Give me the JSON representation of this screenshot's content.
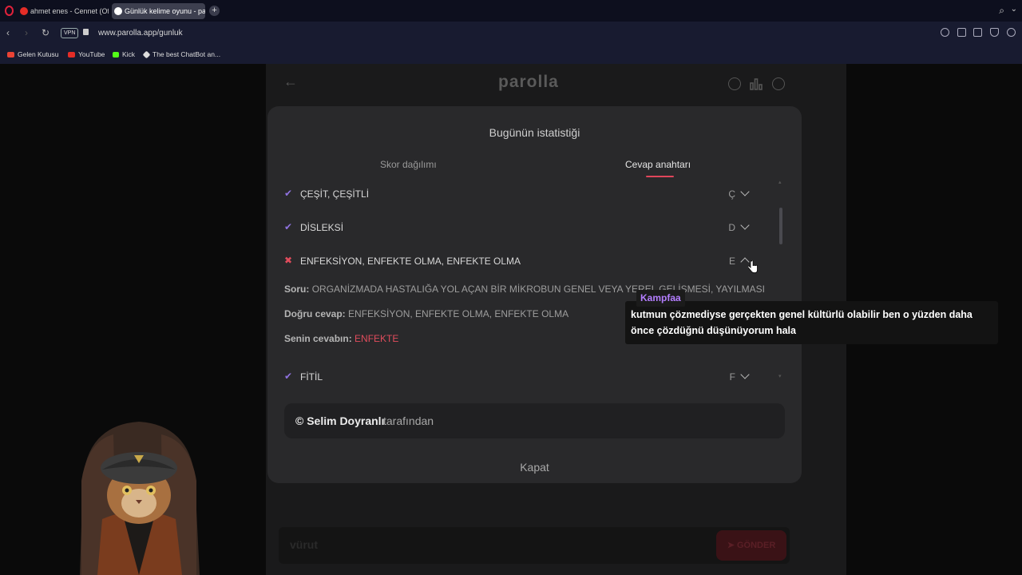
{
  "browser": {
    "tabs": [
      {
        "label": "ahmet enes - Cennet (Offi",
        "icon": "youtube-icon",
        "active": false
      },
      {
        "label": "Günlük kelime oyunu - pa",
        "icon": "parolla-icon",
        "active": true
      }
    ],
    "url": "www.parolla.app/gunluk",
    "vpn_label": "VPN",
    "bookmarks": [
      {
        "label": "Gelen Kutusu",
        "icon": "gmail-icon"
      },
      {
        "label": "YouTube",
        "icon": "youtube-icon"
      },
      {
        "label": "Kick",
        "icon": "kick-icon"
      },
      {
        "label": "The best ChatBot an...",
        "icon": "chatbot-icon"
      }
    ]
  },
  "app": {
    "logo": "parolla",
    "input_placeholder": "vürut",
    "send_label": "GÖNDER"
  },
  "modal": {
    "title": "Bugünün istatistiği",
    "tabs": [
      {
        "label": "Skor dağılımı",
        "active": false
      },
      {
        "label": "Cevap anahtarı",
        "active": true
      }
    ],
    "rows": [
      {
        "status": "correct",
        "answer": "ÇEŞİT, ÇEŞİTLİ",
        "letter": "Ç",
        "expanded": false
      },
      {
        "status": "correct",
        "answer": "DİSLEKSİ",
        "letter": "D",
        "expanded": false
      },
      {
        "status": "wrong",
        "answer": "ENFEKSİYON, ENFEKTE OLMA, ENFEKTE OLMA",
        "letter": "E",
        "expanded": true
      },
      {
        "status": "correct",
        "answer": "FİTİL",
        "letter": "F",
        "expanded": false
      }
    ],
    "detail": {
      "question_label": "Soru:",
      "question": "ORGANİZMADA HASTALIĞA YOL AÇAN BİR MİKROBUN GENEL VEYA YEREL GELİŞMESİ, YAYILMASI",
      "correct_label": "Doğru cevap:",
      "correct": "ENFEKSİYON, ENFEKTE OLMA, ENFEKTE OLMA",
      "yours_label": "Senin cevabın:",
      "yours": "ENFEKTE"
    },
    "credit_name": "© Selim Doyranlı",
    "credit_suffix": "tarafından",
    "close_label": "Kapat",
    "colors": {
      "accent": "#e0465a",
      "check": "#8f72e0",
      "modal_bg": "#29292b"
    }
  },
  "chat": {
    "username": "Kampfaa",
    "username_color": "#b47eff",
    "message": "kutmun çözmediyse gerçekten genel kültürlü olabilir ben o yüzden daha önce çözdüğnü düşünüyorum hala"
  }
}
